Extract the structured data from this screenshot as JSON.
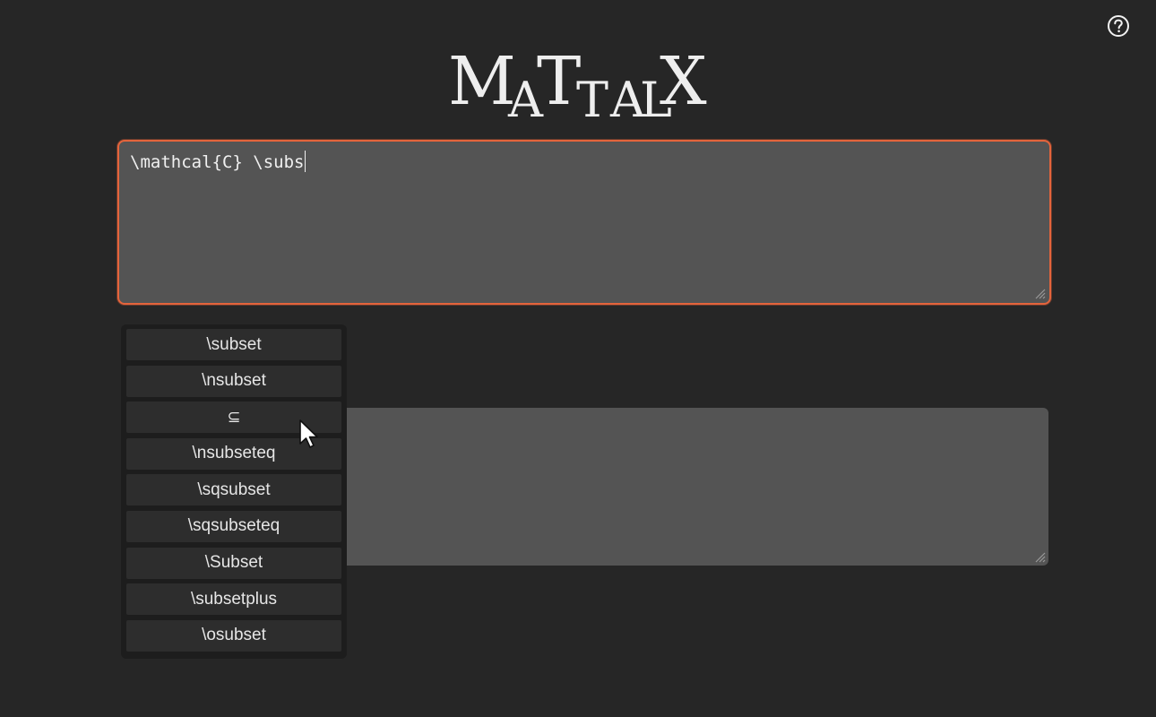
{
  "app": {
    "logo_text": "MATTALX",
    "help_icon": "help-circle-icon"
  },
  "editor": {
    "value": "\\mathcal{C} \\subs"
  },
  "autocomplete": {
    "items": [
      {
        "label": "\\subset"
      },
      {
        "label": "\\nsubset"
      },
      {
        "label": "⊆"
      },
      {
        "label": "\\nsubseteq"
      },
      {
        "label": "\\sqsubset"
      },
      {
        "label": "\\sqsubseteq"
      },
      {
        "label": "\\Subset"
      },
      {
        "label": "\\subsetplus"
      },
      {
        "label": "\\osubset"
      }
    ]
  },
  "colors": {
    "background": "#262626",
    "accent": "#e4643c",
    "field": "#545454",
    "popup": "#1d1d1d",
    "item": "#2d2d2d"
  }
}
